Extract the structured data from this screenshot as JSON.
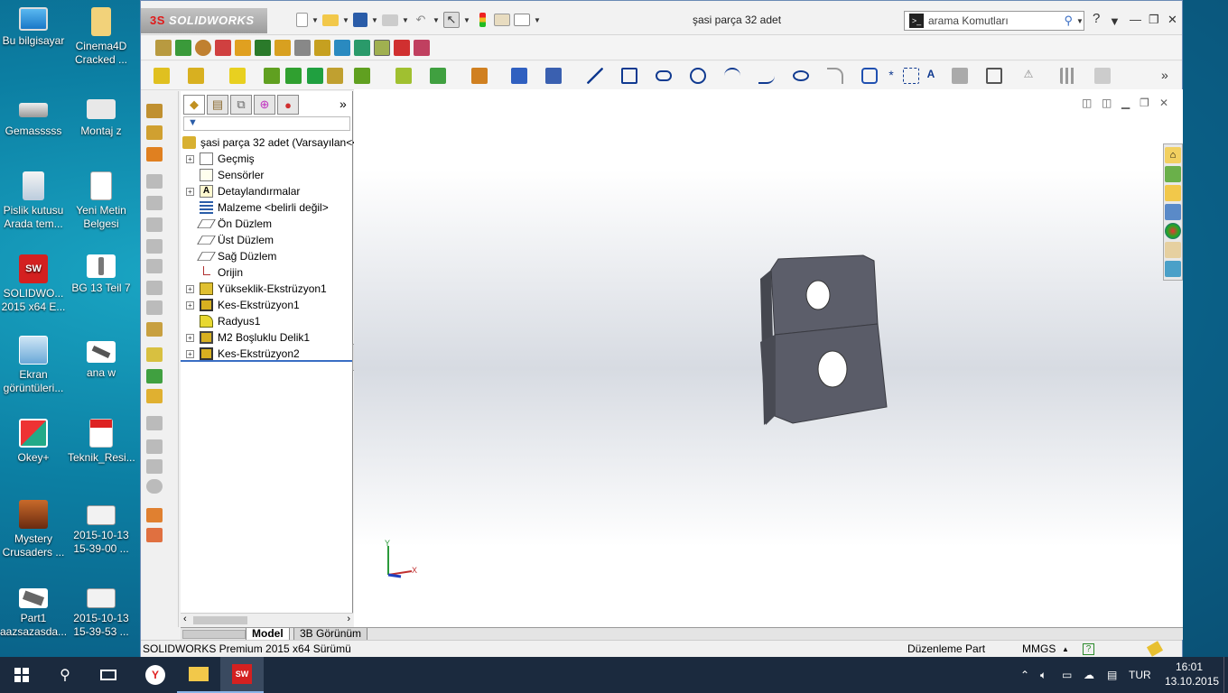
{
  "desktop": {
    "icons": [
      {
        "label": "Bu bilgisayar",
        "icon": "computer-icon"
      },
      {
        "label": "Cinema4D Cracked ...",
        "icon": "folder-icon"
      },
      {
        "label": "Gemasssss",
        "icon": "drive-icon"
      },
      {
        "label": "Montaj z",
        "icon": "assembly-file-icon"
      },
      {
        "label": "Pislik kutusu Arada tem...",
        "icon": "recycle-bin-icon"
      },
      {
        "label": "Yeni Metin Belgesi",
        "icon": "text-document-icon"
      },
      {
        "label": "SOLIDWO... 2015 x64 E...",
        "icon": "solidworks-icon"
      },
      {
        "label": "BG 13 Teil 7",
        "icon": "part-file-icon"
      },
      {
        "label": "Ekran görüntüleri...",
        "icon": "screenshot-folder-icon"
      },
      {
        "label": "ana w",
        "icon": "part-file-icon"
      },
      {
        "label": "Okey+",
        "icon": "game-icon"
      },
      {
        "label": "Teknik_Resi...",
        "icon": "pdf-icon"
      },
      {
        "label": "Mystery Crusaders ...",
        "icon": "game-chest-icon"
      },
      {
        "label": "2015-10-13 15-39-00 ...",
        "icon": "image-file-icon"
      },
      {
        "label": "Part1 aazsazasda...",
        "icon": "part-file-icon"
      },
      {
        "label": "2015-10-13 15-39-53 ...",
        "icon": "image-file-icon"
      }
    ]
  },
  "app": {
    "logo_text": "SOLIDWORKS",
    "logo_prefix": "3S",
    "document_title": "şasi parça 32 adet",
    "search_placeholder": "arama Komutları",
    "help_label": "?",
    "minimize_label": "—",
    "restore_label": "❐",
    "close_label": "✕"
  },
  "feature_manager": {
    "tabs": [
      "feature-tree-tab",
      "property-tab",
      "config-tab",
      "dimxpert-tab",
      "display-tab"
    ],
    "more_label": "»",
    "root": "şasi parça 32 adet  (Varsayılan<<",
    "items": [
      {
        "label": "Geçmiş",
        "expandable": true,
        "icon": "history-icon"
      },
      {
        "label": "Sensörler",
        "expandable": false,
        "icon": "sensor-icon"
      },
      {
        "label": "Detaylandırmalar",
        "expandable": true,
        "icon": "annotation-icon"
      },
      {
        "label": "Malzeme <belirli değil>",
        "expandable": false,
        "icon": "material-icon"
      },
      {
        "label": "Ön Düzlem",
        "expandable": false,
        "icon": "plane-icon"
      },
      {
        "label": "Üst Düzlem",
        "expandable": false,
        "icon": "plane-icon"
      },
      {
        "label": "Sağ Düzlem",
        "expandable": false,
        "icon": "plane-icon"
      },
      {
        "label": "Orijin",
        "expandable": false,
        "icon": "origin-icon"
      },
      {
        "label": "Yükseklik-Ekstrüzyon1",
        "expandable": true,
        "icon": "extrude-icon"
      },
      {
        "label": "Kes-Ekstrüzyon1",
        "expandable": true,
        "icon": "cut-extrude-icon"
      },
      {
        "label": "Radyus1",
        "expandable": false,
        "icon": "fillet-icon"
      },
      {
        "label": "M2 Boşluklu Delik1",
        "expandable": true,
        "icon": "hole-icon"
      },
      {
        "label": "Kes-Ekstrüzyon2",
        "expandable": true,
        "icon": "cut-extrude-icon"
      }
    ]
  },
  "viewport": {
    "triad_x": "X",
    "triad_y": "Y"
  },
  "bottom_tabs": [
    "Model",
    "3B Görünüm"
  ],
  "status_bar": {
    "product": "SOLIDWORKS Premium 2015 x64 Sürümü",
    "mode": "Düzenleme Part",
    "units": "MMGS",
    "units_caret": "▲"
  },
  "taskbar": {
    "language": "TUR",
    "time": "16:01",
    "date": "13.10.2015"
  },
  "colors": {
    "accent": "#3a6ec4",
    "part_face": "#5c5e6a",
    "part_side": "#45474f",
    "taskbar": "#1b2a3e"
  }
}
